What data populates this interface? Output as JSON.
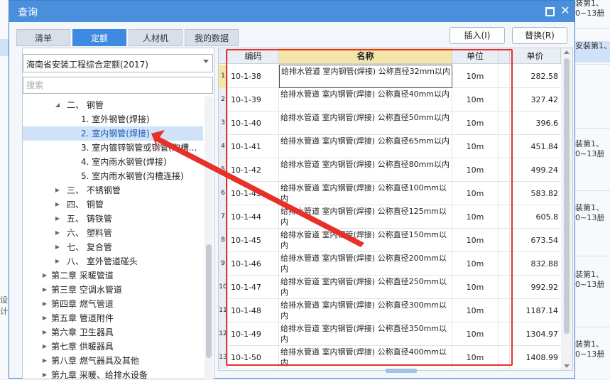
{
  "background": {
    "right_items": [
      {
        "line1": "装第1、",
        "line2": "0~13册"
      },
      {
        "line1": "安装第1、",
        "line2": ""
      },
      {
        "line1": "装第1、",
        "line2": "0~13册"
      },
      {
        "line1": "装第1、",
        "line2": "0~13册"
      },
      {
        "line1": "装第1、",
        "line2": "0~13册"
      },
      {
        "line1": "装第1、",
        "line2": "0~13册"
      }
    ],
    "left_text": "设计"
  },
  "dialog": {
    "title": "查询",
    "tabs": [
      {
        "label": "清单",
        "active": false
      },
      {
        "label": "定额",
        "active": true
      },
      {
        "label": "人材机",
        "active": false
      },
      {
        "label": "我的数据",
        "active": false
      }
    ],
    "buttons": {
      "insert": "插入(I)",
      "replace": "替换(R)"
    },
    "library": "海南省安装工程综合定额(2017)",
    "search_placeholder": "搜索",
    "tree": [
      {
        "label": "二、 钢管",
        "arrow": "◢",
        "level": 2,
        "selected": false
      },
      {
        "label": "1. 室外钢管(焊接)",
        "arrow": "",
        "level": 3,
        "selected": false
      },
      {
        "label": "2. 室内钢管(焊接)",
        "arrow": "",
        "level": 3,
        "selected": true
      },
      {
        "label": "3. 室内镀锌钢管或钢管(沟槽...",
        "arrow": "",
        "level": 3,
        "selected": false
      },
      {
        "label": "4. 室内雨水钢管(焊接)",
        "arrow": "",
        "level": 3,
        "selected": false
      },
      {
        "label": "5. 室内雨水钢管(沟槽连接)",
        "arrow": "",
        "level": 3,
        "selected": false
      },
      {
        "label": "三、 不锈钢管",
        "arrow": "▶",
        "level": 2,
        "selected": false
      },
      {
        "label": "四、 铜管",
        "arrow": "▶",
        "level": 2,
        "selected": false
      },
      {
        "label": "五、 铸铁管",
        "arrow": "▶",
        "level": 2,
        "selected": false
      },
      {
        "label": "六、 塑料管",
        "arrow": "▶",
        "level": 2,
        "selected": false
      },
      {
        "label": "七、 复合管",
        "arrow": "▶",
        "level": 2,
        "selected": false
      },
      {
        "label": "八、 室外管道碰头",
        "arrow": "▶",
        "level": 2,
        "selected": false
      },
      {
        "label": "第二章 采暖管道",
        "arrow": "▶",
        "level": 1,
        "selected": false
      },
      {
        "label": "第三章 空调水管道",
        "arrow": "▶",
        "level": 1,
        "selected": false
      },
      {
        "label": "第四章 燃气管道",
        "arrow": "▶",
        "level": 1,
        "selected": false
      },
      {
        "label": "第五章 管道附件",
        "arrow": "▶",
        "level": 1,
        "selected": false
      },
      {
        "label": "第六章 卫生器具",
        "arrow": "▶",
        "level": 1,
        "selected": false
      },
      {
        "label": "第七章 供暖器具",
        "arrow": "▶",
        "level": 1,
        "selected": false
      },
      {
        "label": "第八章 燃气器具及其他",
        "arrow": "▶",
        "level": 1,
        "selected": false
      },
      {
        "label": "第九章 采暖、给排水设备",
        "arrow": "▶",
        "level": 1,
        "selected": false
      }
    ],
    "grid": {
      "headers": {
        "idx": "",
        "code": "编码",
        "name": "名称",
        "unit": "单位",
        "price": "单价"
      },
      "rows": [
        {
          "idx": "1",
          "code": "10-1-38",
          "name": "给排水管道 室内钢管(焊接) 公称直径32mm以内",
          "unit": "10m",
          "price": "282.58"
        },
        {
          "idx": "2",
          "code": "10-1-39",
          "name": "给排水管道 室内钢管(焊接) 公称直径40mm以内",
          "unit": "10m",
          "price": "327.42"
        },
        {
          "idx": "3",
          "code": "10-1-40",
          "name": "给排水管道 室内钢管(焊接) 公称直径50mm以内",
          "unit": "10m",
          "price": "396.6"
        },
        {
          "idx": "4",
          "code": "10-1-41",
          "name": "给排水管道 室内钢管(焊接) 公称直径65mm以内",
          "unit": "10m",
          "price": "451.84"
        },
        {
          "idx": "5",
          "code": "10-1-42",
          "name": "给排水管道 室内钢管(焊接) 公称直径80mm以内",
          "unit": "10m",
          "price": "499.24"
        },
        {
          "idx": "6",
          "code": "10-1-43",
          "name": "给排水管道 室内钢管(焊接) 公称直径100mm以内",
          "unit": "10m",
          "price": "583.82"
        },
        {
          "idx": "7",
          "code": "10-1-44",
          "name": "给排水管道 室内钢管(焊接) 公称直径125mm以内",
          "unit": "10m",
          "price": "605.8"
        },
        {
          "idx": "8",
          "code": "10-1-45",
          "name": "给排水管道 室内钢管(焊接) 公称直径150mm以内",
          "unit": "10m",
          "price": "673.54"
        },
        {
          "idx": "9",
          "code": "10-1-46",
          "name": "给排水管道 室内钢管(焊接) 公称直径200mm以内",
          "unit": "10m",
          "price": "832.88"
        },
        {
          "idx": "10",
          "code": "10-1-47",
          "name": "给排水管道 室内钢管(焊接) 公称直径250mm以内",
          "unit": "10m",
          "price": "992.92"
        },
        {
          "idx": "11",
          "code": "10-1-48",
          "name": "给排水管道 室内钢管(焊接) 公称直径300mm以内",
          "unit": "10m",
          "price": "1187.14"
        },
        {
          "idx": "12",
          "code": "10-1-49",
          "name": "给排水管道 室内钢管(焊接) 公称直径350mm以内",
          "unit": "10m",
          "price": "1304.97"
        },
        {
          "idx": "13",
          "code": "10-1-50",
          "name": "给排水管道 室内钢管(焊接) 公称直径400mm以内",
          "unit": "10m",
          "price": "1408.99"
        }
      ]
    }
  },
  "colors": {
    "title_bar": "#4a8fdc",
    "active_tab": "#3d8ae0",
    "name_header": "#f4e5a8",
    "annotation": "#e8302a",
    "selection": "#cfe2f7"
  }
}
